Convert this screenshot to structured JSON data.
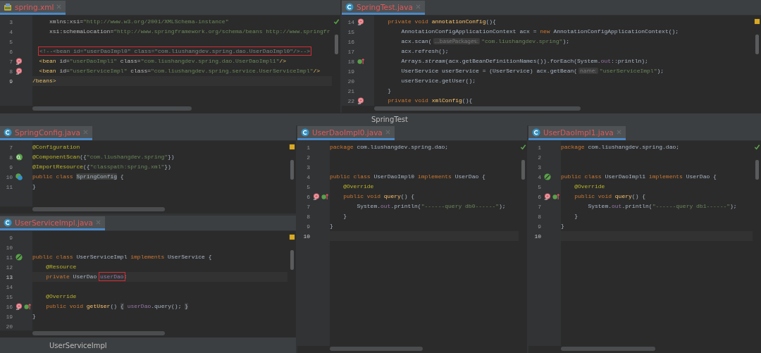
{
  "editors": [
    {
      "tab": {
        "label": "spring.xml",
        "kind": "xml",
        "selected": true
      },
      "inspection": {
        "kind": "ok"
      },
      "lines": [
        {
          "number": "3",
          "current": false,
          "tokens": [
            {
              "t": "     xmlns:xsi=",
              "kind": "attr"
            },
            {
              "t": "\"http://www.w3.org/2001/XMLSchema-instance\"",
              "kind": "str"
            }
          ]
        },
        {
          "number": "4",
          "current": false,
          "tokens": [
            {
              "t": "     xsi:schemaLocation=",
              "kind": "attr"
            },
            {
              "t": "\"http://www.springframework.org/schema/beans http://www.springfr",
              "kind": "str"
            }
          ]
        },
        {
          "number": "5",
          "current": false
        },
        {
          "number": "6",
          "current": false,
          "tokens": [
            {
              "t": "<!--<bean id=\"userDaoImpl0\" class=\"com.liushangdev.spring.dao.UserDaoImpl0\"/>-->",
              "kind": "comment",
              "boxed": true
            }
          ]
        },
        {
          "number": "7",
          "current": false,
          "gutter": [
            {
              "kind": "bean"
            }
          ],
          "tokens": [
            {
              "t": "  <bean",
              "kind": "tag"
            },
            {
              "t": " id=",
              "kind": "attr"
            },
            {
              "t": "\"userDaoImpl1\"",
              "kind": "str"
            },
            {
              "t": " class=",
              "kind": "attr"
            },
            {
              "t": "\"com.liushangdev.spring.dao.UserDaoImpl1\"",
              "kind": "str"
            },
            {
              "t": "/>",
              "kind": "tag"
            }
          ]
        },
        {
          "number": "8",
          "current": false,
          "gutter": [
            {
              "kind": "bean"
            }
          ],
          "tokens": [
            {
              "t": "  <bean",
              "kind": "tag"
            },
            {
              "t": " id=",
              "kind": "attr"
            },
            {
              "t": "\"userServiceImpl\"",
              "kind": "str"
            },
            {
              "t": " class=",
              "kind": "attr"
            },
            {
              "t": "\"com.liushangdev.spring.service.UserServiceImpl\"",
              "kind": "str"
            },
            {
              "t": "/>",
              "kind": "tag"
            }
          ]
        },
        {
          "number": "9",
          "current": true,
          "tokens": [
            {
              "t": "/beans>",
              "kind": "tag"
            }
          ]
        }
      ]
    },
    {
      "tab": {
        "label": "SpringTest.java",
        "kind": "class",
        "selected": true
      },
      "inspection": {
        "kind": "warning"
      },
      "lines": [
        {
          "number": "14",
          "current": false,
          "gutter": [
            {
              "kind": "bean"
            }
          ],
          "tokens": [
            {
              "t": "    private void ",
              "kind": "kw"
            },
            {
              "t": "annotationConfig",
              "kind": "fn"
            },
            {
              "t": "(){",
              "kind": "plain"
            }
          ]
        },
        {
          "number": "15",
          "current": false,
          "tokens": [
            {
              "t": "        AnnotationConfigApplicationContext acx = ",
              "kind": "plain"
            },
            {
              "t": "new",
              "kind": "kw"
            },
            {
              "t": " AnnotationConfigApplicationContext();",
              "kind": "plain"
            }
          ]
        },
        {
          "number": "16",
          "current": false,
          "tokens": [
            {
              "t": "        acx.scan(",
              "kind": "plain"
            },
            {
              "t": "...basePackages:",
              "kind": "hint"
            },
            {
              "t": "\"com.liushangdev.spring\"",
              "kind": "str"
            },
            {
              "t": ");",
              "kind": "plain"
            }
          ]
        },
        {
          "number": "17",
          "current": false,
          "tokens": [
            {
              "t": "        acx.refresh();",
              "kind": "plain"
            }
          ]
        },
        {
          "number": "18",
          "current": false,
          "gutter": [
            {
              "kind": "override"
            }
          ],
          "tokens": [
            {
              "t": "        Arrays.",
              "kind": "plain"
            },
            {
              "t": "stream",
              "kind": "static"
            },
            {
              "t": "(acx.getBeanDefinitionNames()).forEach(System.",
              "kind": "plain"
            },
            {
              "t": "out",
              "kind": "field"
            },
            {
              "t": "::println);",
              "kind": "plain"
            }
          ]
        },
        {
          "number": "19",
          "current": false,
          "tokens": [
            {
              "t": "        UserService userService = (UserService) acx.getBean(",
              "kind": "plain"
            },
            {
              "t": "name:",
              "kind": "hint"
            },
            {
              "t": "\"userServiceImpl\"",
              "kind": "str"
            },
            {
              "t": ");",
              "kind": "plain"
            }
          ]
        },
        {
          "number": "20",
          "current": false,
          "tokens": [
            {
              "t": "        userService.getUser();",
              "kind": "plain"
            }
          ]
        },
        {
          "number": "21",
          "current": false,
          "tokens": [
            {
              "t": "    }",
              "kind": "plain"
            }
          ]
        },
        {
          "number": "22",
          "current": false,
          "gutter": [
            {
              "kind": "bean"
            }
          ],
          "tokens": [
            {
              "t": "    private void ",
              "kind": "kw"
            },
            {
              "t": "xmlConfig",
              "kind": "fn"
            },
            {
              "t": "(){",
              "kind": "plain"
            }
          ]
        }
      ]
    },
    {
      "tab": {
        "label": "SpringConfig.java",
        "kind": "class",
        "selected": true
      },
      "inspection": {
        "kind": "warning"
      },
      "lines": [
        {
          "number": "7",
          "current": false,
          "tokens": [
            {
              "t": "@Configuration",
              "kind": "ann"
            }
          ]
        },
        {
          "number": "8",
          "current": false,
          "gutter": [
            {
              "kind": "search-bean"
            }
          ],
          "tokens": [
            {
              "t": "@ComponentScan",
              "kind": "ann"
            },
            {
              "t": "({",
              "kind": "plain"
            },
            {
              "t": "\"com.liushangdev.spring\"",
              "kind": "str"
            },
            {
              "t": "})",
              "kind": "plain"
            }
          ]
        },
        {
          "number": "9",
          "current": false,
          "tokens": [
            {
              "t": "@ImportResource",
              "kind": "ann"
            },
            {
              "t": "({",
              "kind": "plain"
            },
            {
              "t": "\"classpath:spring.xml\"",
              "kind": "str"
            },
            {
              "t": "})",
              "kind": "plain"
            }
          ]
        },
        {
          "number": "10",
          "current": false,
          "gutter": [
            {
              "kind": "spring-class"
            }
          ],
          "tokens": [
            {
              "t": "public class ",
              "kind": "kw"
            },
            {
              "t": "SpringConfig",
              "kind": "highlight"
            },
            {
              "t": " {",
              "kind": "plain"
            }
          ]
        },
        {
          "number": "11",
          "current": false,
          "tokens": [
            {
              "t": "}",
              "kind": "plain"
            }
          ]
        }
      ]
    },
    {
      "tab": {
        "label": "UserServiceImpl.java",
        "kind": "class",
        "selected": true
      },
      "inspection": {
        "kind": "warning"
      },
      "lines": [
        {
          "number": "9",
          "current": false
        },
        {
          "number": "10",
          "current": false
        },
        {
          "number": "11",
          "current": false,
          "gutter": [
            {
              "kind": "spring"
            }
          ],
          "tokens": [
            {
              "t": "public class ",
              "kind": "kw"
            },
            {
              "t": "UserServiceImpl ",
              "kind": "plain"
            },
            {
              "t": "implements ",
              "kind": "kw"
            },
            {
              "t": "UserService {",
              "kind": "plain"
            }
          ]
        },
        {
          "number": "12",
          "current": false,
          "tokens": [
            {
              "t": "    @Resource",
              "kind": "ann"
            }
          ]
        },
        {
          "number": "13",
          "current": true,
          "tokens": [
            {
              "t": "    private ",
              "kind": "kw"
            },
            {
              "t": "UserDao ",
              "kind": "plain"
            },
            {
              "t": "userDao",
              "kind": "field",
              "boxed": true
            },
            {
              "t": ";",
              "kind": "plain"
            }
          ]
        },
        {
          "number": "14",
          "current": false
        },
        {
          "number": "15",
          "current": false,
          "tokens": [
            {
              "t": "    @Override",
              "kind": "ann"
            }
          ]
        },
        {
          "number": "16",
          "current": false,
          "gutter": [
            {
              "kind": "bean"
            },
            {
              "kind": "override"
            }
          ],
          "tokens": [
            {
              "t": "    public void ",
              "kind": "kw"
            },
            {
              "t": "getUser",
              "kind": "fn"
            },
            {
              "t": "() ",
              "kind": "plain"
            },
            {
              "t": "{",
              "kind": "fold"
            },
            {
              "t": "userDao",
              "kind": "field"
            },
            {
              "t": ".query(); ",
              "kind": "plain"
            },
            {
              "t": "}",
              "kind": "fold"
            }
          ]
        },
        {
          "number": "19",
          "current": false,
          "tokens": [
            {
              "t": "}",
              "kind": "plain"
            }
          ]
        },
        {
          "number": "20",
          "current": false
        }
      ]
    },
    {
      "tab": {
        "label": "UserDaoImpl0.java",
        "kind": "class",
        "selected": true
      },
      "inspection": {
        "kind": "ok"
      },
      "lines": [
        {
          "number": "1",
          "current": false,
          "tokens": [
            {
              "t": "package ",
              "kind": "kw"
            },
            {
              "t": "com.liushangdev.spring.dao;",
              "kind": "plain"
            }
          ]
        },
        {
          "number": "2",
          "current": false
        },
        {
          "number": "3",
          "current": false
        },
        {
          "number": "4",
          "current": false,
          "tokens": [
            {
              "t": "public class ",
              "kind": "kw"
            },
            {
              "t": "UserDaoImpl0 ",
              "kind": "plain"
            },
            {
              "t": "implements ",
              "kind": "kw"
            },
            {
              "t": "UserDao {",
              "kind": "plain"
            }
          ]
        },
        {
          "number": "5",
          "current": false,
          "tokens": [
            {
              "t": "    @Override",
              "kind": "ann"
            }
          ]
        },
        {
          "number": "6",
          "current": false,
          "gutter": [
            {
              "kind": "bean"
            },
            {
              "kind": "override"
            }
          ],
          "tokens": [
            {
              "t": "    public void ",
              "kind": "kw"
            },
            {
              "t": "query",
              "kind": "fn"
            },
            {
              "t": "() {",
              "kind": "plain"
            }
          ]
        },
        {
          "number": "7",
          "current": false,
          "tokens": [
            {
              "t": "        System.",
              "kind": "plain"
            },
            {
              "t": "out",
              "kind": "field"
            },
            {
              "t": ".println(",
              "kind": "plain"
            },
            {
              "t": "\"------query db0------\"",
              "kind": "str"
            },
            {
              "t": ");",
              "kind": "plain"
            }
          ]
        },
        {
          "number": "8",
          "current": false,
          "tokens": [
            {
              "t": "    }",
              "kind": "plain"
            }
          ]
        },
        {
          "number": "9",
          "current": false,
          "tokens": [
            {
              "t": "}",
              "kind": "plain"
            }
          ]
        },
        {
          "number": "10",
          "current": true
        }
      ]
    },
    {
      "tab": {
        "label": "UserDaoImpl1.java",
        "kind": "class",
        "selected": true
      },
      "inspection": {
        "kind": "ok"
      },
      "lines": [
        {
          "number": "1",
          "current": false,
          "tokens": [
            {
              "t": "package ",
              "kind": "kw"
            },
            {
              "t": "com.liushangdev.spring.dao;",
              "kind": "plain"
            }
          ]
        },
        {
          "number": "2",
          "current": false
        },
        {
          "number": "3",
          "current": false
        },
        {
          "number": "4",
          "current": false,
          "gutter": [
            {
              "kind": "spring"
            }
          ],
          "tokens": [
            {
              "t": "public class ",
              "kind": "kw"
            },
            {
              "t": "UserDaoImpl1 ",
              "kind": "plain"
            },
            {
              "t": "implements ",
              "kind": "kw"
            },
            {
              "t": "UserDao {",
              "kind": "plain"
            }
          ]
        },
        {
          "number": "5",
          "current": false,
          "tokens": [
            {
              "t": "    @Override",
              "kind": "ann"
            }
          ]
        },
        {
          "number": "6",
          "current": false,
          "gutter": [
            {
              "kind": "bean"
            },
            {
              "kind": "override"
            }
          ],
          "tokens": [
            {
              "t": "    public void ",
              "kind": "kw"
            },
            {
              "t": "query",
              "kind": "fn"
            },
            {
              "t": "() {",
              "kind": "plain"
            }
          ]
        },
        {
          "number": "7",
          "current": false,
          "tokens": [
            {
              "t": "        System.",
              "kind": "plain"
            },
            {
              "t": "out",
              "kind": "field"
            },
            {
              "t": ".println(",
              "kind": "plain"
            },
            {
              "t": "\"------query db1------\"",
              "kind": "str"
            },
            {
              "t": ");",
              "kind": "plain"
            }
          ]
        },
        {
          "number": "8",
          "current": false,
          "tokens": [
            {
              "t": "    }",
              "kind": "plain"
            }
          ]
        },
        {
          "number": "9",
          "current": false,
          "tokens": [
            {
              "t": "}",
              "kind": "plain"
            }
          ]
        },
        {
          "number": "10",
          "current": true
        }
      ]
    }
  ],
  "split_title": "SpringTest",
  "breadcrumb": "UserServiceImpl"
}
